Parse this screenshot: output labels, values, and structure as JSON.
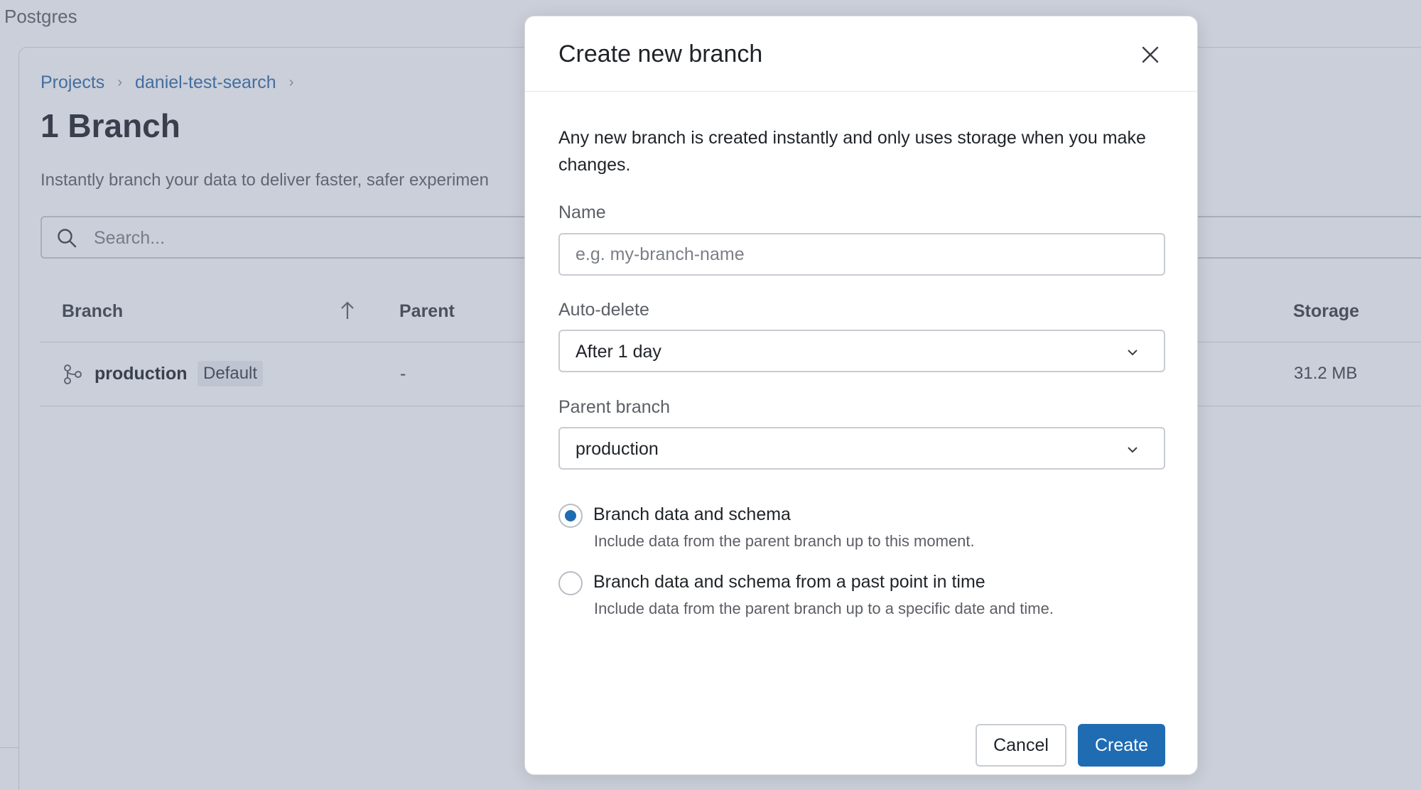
{
  "app": {
    "title": "Postgres"
  },
  "breadcrumb": {
    "items": [
      "Projects",
      "daniel-test-search"
    ]
  },
  "page": {
    "title": "1 Branch",
    "description": "Instantly branch your data to deliver faster, safer experimen"
  },
  "search": {
    "placeholder": "Search..."
  },
  "table": {
    "columns": {
      "branch": "Branch",
      "parent": "Parent",
      "storage": "Storage"
    },
    "rows": [
      {
        "name": "production",
        "badge": "Default",
        "parent": "-",
        "storage": "31.2 MB"
      }
    ]
  },
  "modal": {
    "title": "Create new branch",
    "intro": "Any new branch is created instantly and only uses storage when you make changes.",
    "name_field": {
      "label": "Name",
      "placeholder": "e.g. my-branch-name",
      "value": ""
    },
    "auto_delete": {
      "label": "Auto-delete",
      "value": "After 1 day"
    },
    "parent_branch": {
      "label": "Parent branch",
      "value": "production"
    },
    "options": [
      {
        "label": "Branch data and schema",
        "description": "Include data from the parent branch up to this moment.",
        "checked": true
      },
      {
        "label": "Branch data and schema from a past point in time",
        "description": "Include data from the parent branch up to a specific date and time.",
        "checked": false
      }
    ],
    "cancel_label": "Cancel",
    "create_label": "Create"
  },
  "colors": {
    "accent": "#1f6cb3",
    "link": "#2f6ba8"
  },
  "icons": [
    "search-icon",
    "sort-ascending-icon",
    "branch-icon",
    "close-icon",
    "chevron-down-icon"
  ]
}
